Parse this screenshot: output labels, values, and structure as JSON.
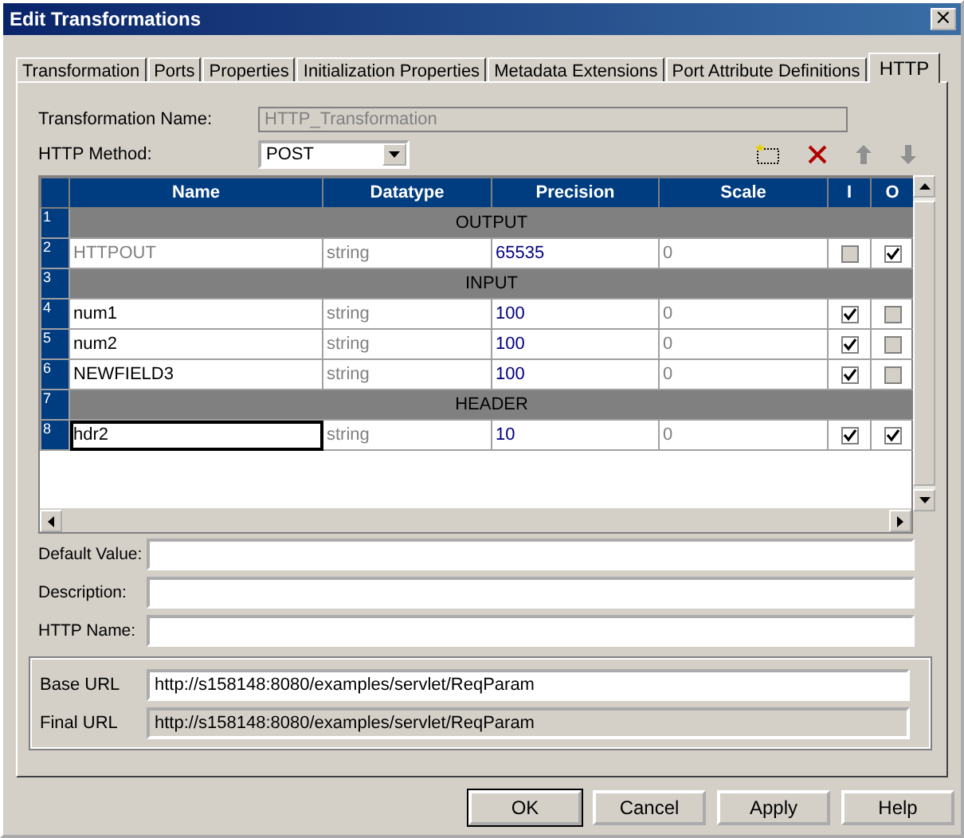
{
  "window": {
    "title": "Edit Transformations",
    "close": "×"
  },
  "tabs": [
    {
      "label": "Transformation",
      "selected": false
    },
    {
      "label": "Ports",
      "selected": false
    },
    {
      "label": "Properties",
      "selected": false
    },
    {
      "label": "Initialization Properties",
      "selected": false
    },
    {
      "label": "Metadata Extensions",
      "selected": false
    },
    {
      "label": "Port Attribute Definitions",
      "selected": false
    },
    {
      "label": "HTTP",
      "selected": true
    }
  ],
  "transformation_name": {
    "label": "Transformation Name:",
    "value": "HTTP_Transformation"
  },
  "http_method": {
    "label": "HTTP Method:",
    "value": "POST"
  },
  "table": {
    "columns": [
      "Name",
      "Datatype",
      "Precision",
      "Scale",
      "I",
      "O"
    ],
    "rows": [
      {
        "kind": "group",
        "number": "1",
        "label": "OUTPUT"
      },
      {
        "kind": "port",
        "number": "2",
        "name": "HTTPOUT",
        "datatype": "string",
        "precision": "65535",
        "scale": "0",
        "input": false,
        "output": true,
        "disabled": true,
        "selected": false
      },
      {
        "kind": "group",
        "number": "3",
        "label": "INPUT"
      },
      {
        "kind": "port",
        "number": "4",
        "name": "num1",
        "datatype": "string",
        "precision": "100",
        "scale": "0",
        "input": true,
        "output": false,
        "disabled": false,
        "selected": false
      },
      {
        "kind": "port",
        "number": "5",
        "name": "num2",
        "datatype": "string",
        "precision": "100",
        "scale": "0",
        "input": true,
        "output": false,
        "disabled": false,
        "selected": false
      },
      {
        "kind": "port",
        "number": "6",
        "name": "NEWFIELD3",
        "datatype": "string",
        "precision": "100",
        "scale": "0",
        "input": true,
        "output": false,
        "disabled": false,
        "selected": false
      },
      {
        "kind": "group",
        "number": "7",
        "label": "HEADER"
      },
      {
        "kind": "port",
        "number": "8",
        "name": "hdr2",
        "datatype": "string",
        "precision": "10",
        "scale": "0",
        "input": true,
        "output": true,
        "disabled": false,
        "selected": true
      }
    ]
  },
  "fields": [
    {
      "label": "Default Value:"
    },
    {
      "label": "Description:"
    },
    {
      "label": "HTTP Name:"
    }
  ],
  "url": {
    "base_label": "Base URL",
    "base_value": "http://s158148:8080/examples/servlet/ReqParam",
    "final_label": "Final URL",
    "final_value": "http://s158148:8080/examples/servlet/ReqParam"
  },
  "buttons": [
    "OK",
    "Cancel",
    "Apply",
    "Help"
  ]
}
